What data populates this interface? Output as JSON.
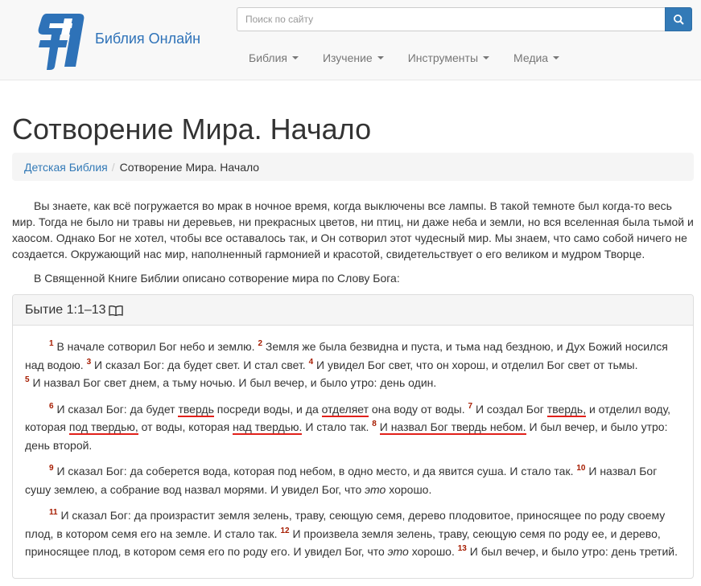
{
  "header": {
    "site_name": "Библия Онлайн",
    "search_placeholder": "Поиск по сайту",
    "nav": [
      {
        "label": "Библия"
      },
      {
        "label": "Изучение"
      },
      {
        "label": "Инструменты"
      },
      {
        "label": "Медиа"
      }
    ]
  },
  "page": {
    "title": "Сотворение Мира. Начало",
    "breadcrumb": {
      "parent": "Детская Библия",
      "separator": "/",
      "current": "Сотворение Мира. Начало"
    },
    "intro": [
      "Вы знаете, как всё погружается во мрак в ночное время, когда выключены все лампы. В такой темноте был когда-то весь мир. Тогда не было ни травы ни деревьев, ни прекрасных цветов, ни птиц, ни даже неба и земли, но вся вселенная была тьмой и хаосом. Однако Бог не хотел, чтобы все оставалось так, и Он сотворил этот чудесный мир. Мы знаем, что само собой ничего не создается. Окружающий нас мир, наполненный гармонией и красотой, свидетельствует о его великом и мудром Творце.",
      "В Священной Книге Библии описано сотворение мира по Слову Бога:"
    ]
  },
  "passage": {
    "reference": "Бытие 1:1–13",
    "icon": "book-icon",
    "highlight_color": "#e2201a",
    "verse_number_color": "#a61c00",
    "verses": {
      "v1": {
        "num": "1",
        "text": "В начале сотворил Бог небо и землю."
      },
      "v2": {
        "num": "2",
        "text": "Земля же была безвидна и пуста, и тьма над бездною, и Дух Божий носился над водою."
      },
      "v3": {
        "num": "3",
        "text": "И сказал Бог: да будет свет. И стал свет."
      },
      "v4": {
        "num": "4",
        "text": "И увидел Бог свет, что он хорош, и отделил Бог свет от тьмы."
      },
      "v5": {
        "num": "5",
        "text": "И назвал Бог свет днем, а тьму ночью. И был вечер, и было утро: день один."
      },
      "v6": {
        "num": "6",
        "a": "И сказал Бог: да будет ",
        "hl1": "твердь",
        "b": " посреди воды, и да ",
        "hl2": "отделяет",
        "c": " она воду от воды."
      },
      "v7": {
        "num": "7",
        "a": "И создал Бог ",
        "hl1": "твердь,",
        "b": " и отделил воду, которая ",
        "hl2": "под твердью,",
        "c": " от воды, которая ",
        "hl3": "над твердью.",
        "d": " И стало так."
      },
      "v8": {
        "num": "8",
        "hl1": "И назвал Бог твердь небом.",
        "a": " И был вечер, и было утро: день второй."
      },
      "v9": {
        "num": "9",
        "text": "И сказал Бог: да соберется вода, которая под небом, в одно место, и да явится суша. И стало так."
      },
      "v10": {
        "num": "10",
        "a": "И назвал Бог сушу землею, а собрание вод назвал морями. И увидел Бог, что ",
        "em": "это",
        "b": " хорошо."
      },
      "v11": {
        "num": "11",
        "text": "И сказал Бог: да произрастит земля зелень, траву, сеющую семя, дерево плодовитое, приносящее по роду своему плод, в котором семя его на земле. И стало так."
      },
      "v12": {
        "num": "12",
        "a": "И произвела земля зелень, траву, сеющую семя по роду ее, и дерево, приносящее плод, в котором семя его по роду его. И увидел Бог, что ",
        "em": "это",
        "b": " хорошо."
      },
      "v13": {
        "num": "13",
        "text": "И был вечер, и было утро: день третий."
      }
    }
  }
}
